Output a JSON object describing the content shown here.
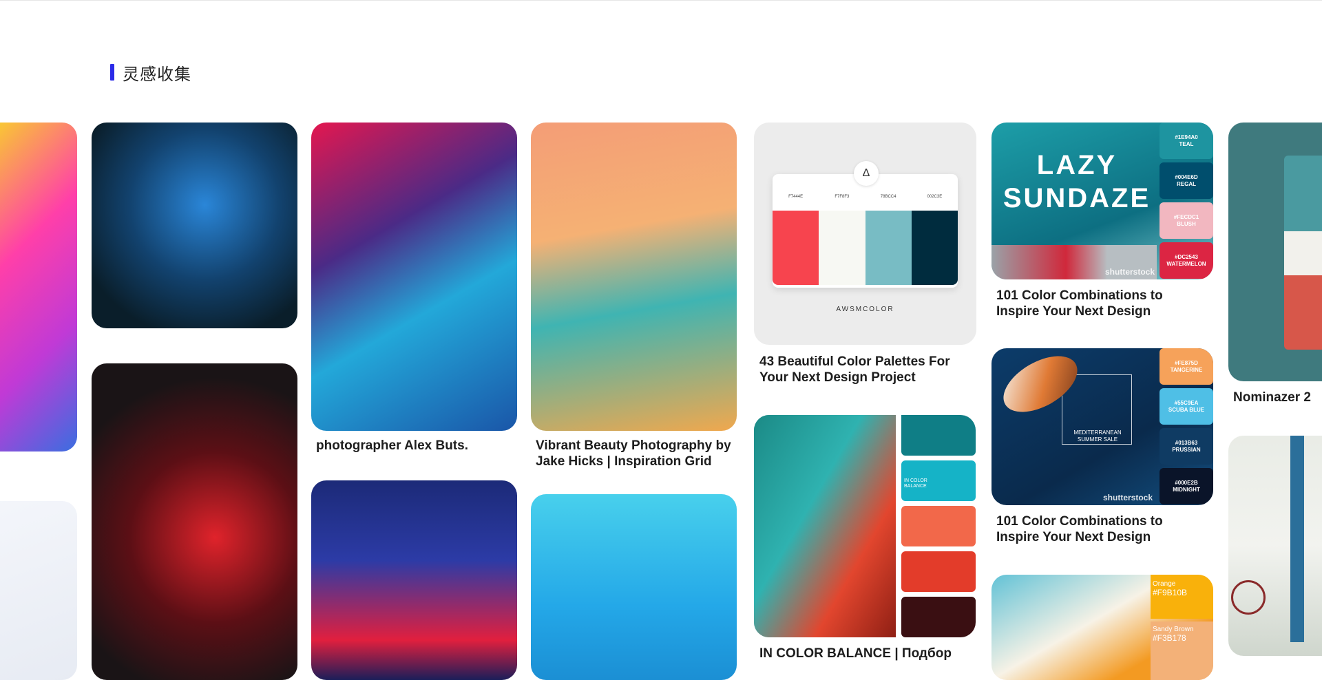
{
  "section": {
    "title": "灵感收集"
  },
  "palette_card": {
    "codes": [
      "F7444E",
      "F7F8F3",
      "78BCC4",
      "002C3E"
    ],
    "swatches": [
      "#F7444E",
      "#F7F8F3",
      "#78BCC4",
      "#002C3E"
    ],
    "logo_glyph": "Δ",
    "brand": "AWSMCOLOR"
  },
  "net_card": {
    "swatches": [
      "#0f7e86",
      "#15b3c7",
      "#f2684a",
      "#e33c2a",
      "#3a0f12"
    ],
    "label": "IN COLOR BALANCE"
  },
  "lazy_card": {
    "title": "LAZY SUNDAZE",
    "watermark": "shutterstock",
    "swatches": [
      {
        "hex": "#1E94A0",
        "name": "TEAL",
        "color": "#1e94a0"
      },
      {
        "hex": "#004E6D",
        "name": "REGAL",
        "color": "#004e6d"
      },
      {
        "hex": "#FECDC1",
        "name": "BLUSH",
        "color": "#f2b7c0"
      },
      {
        "hex": "#DC2543",
        "name": "WATERMELON",
        "color": "#dc2543"
      }
    ]
  },
  "boat_card": {
    "text": "MEDITERRANEAN SUMMER SALE",
    "watermark": "shutterstock",
    "swatches": [
      {
        "hex": "#FE875D",
        "name": "TANGERINE",
        "color": "#f6a25a"
      },
      {
        "hex": "#55C9EA",
        "name": "SCUBA BLUE",
        "color": "#4fbfe6"
      },
      {
        "hex": "#013B63",
        "name": "PRUSSIAN",
        "color": "#0f3b63"
      },
      {
        "hex": "#000E2B",
        "name": "MIDNIGHT",
        "color": "#0a1429"
      }
    ]
  },
  "orange_card": {
    "swatches": [
      {
        "name": "Orange",
        "hex": "#F9B10B",
        "color": "#f9b10b"
      },
      {
        "name": "Sandy Brown",
        "hex": "#F3B178",
        "color": "#f3b178"
      }
    ]
  },
  "nominazer_card": {
    "swatches": [
      "#4a9aa0",
      "#f2f1ec",
      "#d7574a"
    ]
  },
  "captions": {
    "alex": "photographer Alex Buts.",
    "vibrant": "Vibrant Beauty Photography by Jake Hicks | Inspiration Grid",
    "palettes43": "43 Beautiful Color Palettes For Your Next Design Project",
    "lazy": "101 Color Combinations to Inspire Your Next Design",
    "boat": "101 Color Combinations to Inspire Your Next Design",
    "nominazer": "Nominazer 2",
    "balance": "IN COLOR BALANCE | Подбор"
  }
}
